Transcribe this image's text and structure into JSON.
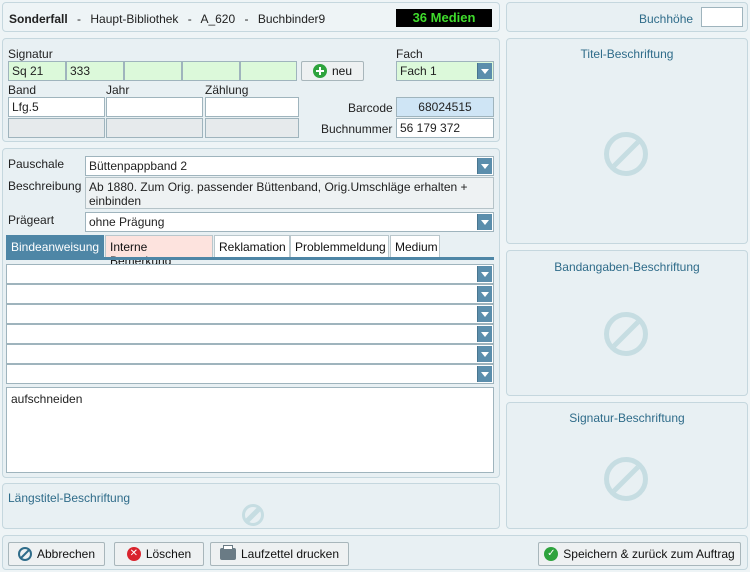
{
  "header": {
    "title": "Sonderfall",
    "sep1": "-",
    "library": "Haupt-Bibliothek",
    "sep2": "-",
    "code": "A_620",
    "sep3": "-",
    "binder": "Buchbinder9",
    "media_count": "36 Medien"
  },
  "buchhoehe": {
    "label": "Buchhöhe",
    "value": ""
  },
  "signatur": {
    "label": "Signatur",
    "parts": [
      "Sq 21",
      "333",
      "",
      "",
      ""
    ],
    "new_button": "neu"
  },
  "fach": {
    "label": "Fach",
    "value": "Fach 1"
  },
  "band": {
    "label": "Band",
    "value": "Lfg.5",
    "value2": ""
  },
  "jahr": {
    "label": "Jahr",
    "value": "",
    "value2": ""
  },
  "zaehlung": {
    "label": "Zählung",
    "value": "",
    "value2": ""
  },
  "barcode": {
    "label": "Barcode",
    "value": "68024515"
  },
  "buchnummer": {
    "label": "Buchnummer",
    "value": "56 179 372"
  },
  "pauschale": {
    "label": "Pauschale",
    "value": "Büttenpappband 2"
  },
  "beschreibung": {
    "label": "Beschreibung",
    "value": "Ab 1880. Zum Orig. passender Büttenband, Orig.Umschläge erhalten + einbinden"
  },
  "praegeart": {
    "label": "Prägeart",
    "value": "ohne Prägung"
  },
  "tabs": [
    "Bindeanweisung",
    "Interne Bemerkung",
    "Reklamation",
    "Problemmeldung",
    "Medium"
  ],
  "instructions": {
    "dropdowns": [
      "",
      "",
      "",
      "",
      "",
      ""
    ],
    "text": "aufschneiden"
  },
  "laengstitel": {
    "label": "Längstitel-Beschriftung"
  },
  "right": {
    "titel": "Titel-Beschriftung",
    "bandangaben": "Bandangaben-Beschriftung",
    "signatur": "Signatur-Beschriftung"
  },
  "footer": {
    "cancel": "Abbrechen",
    "delete": "Löschen",
    "print": "Laufzettel drucken",
    "save": "Speichern & zurück zum Auftrag"
  },
  "colors": {
    "accent": "#2f6c8a",
    "media_badge_bg": "#000000",
    "media_badge_fg": "#3fdc2c",
    "tab_active": "#4e86a6",
    "tab_warn": "#fde3de"
  }
}
